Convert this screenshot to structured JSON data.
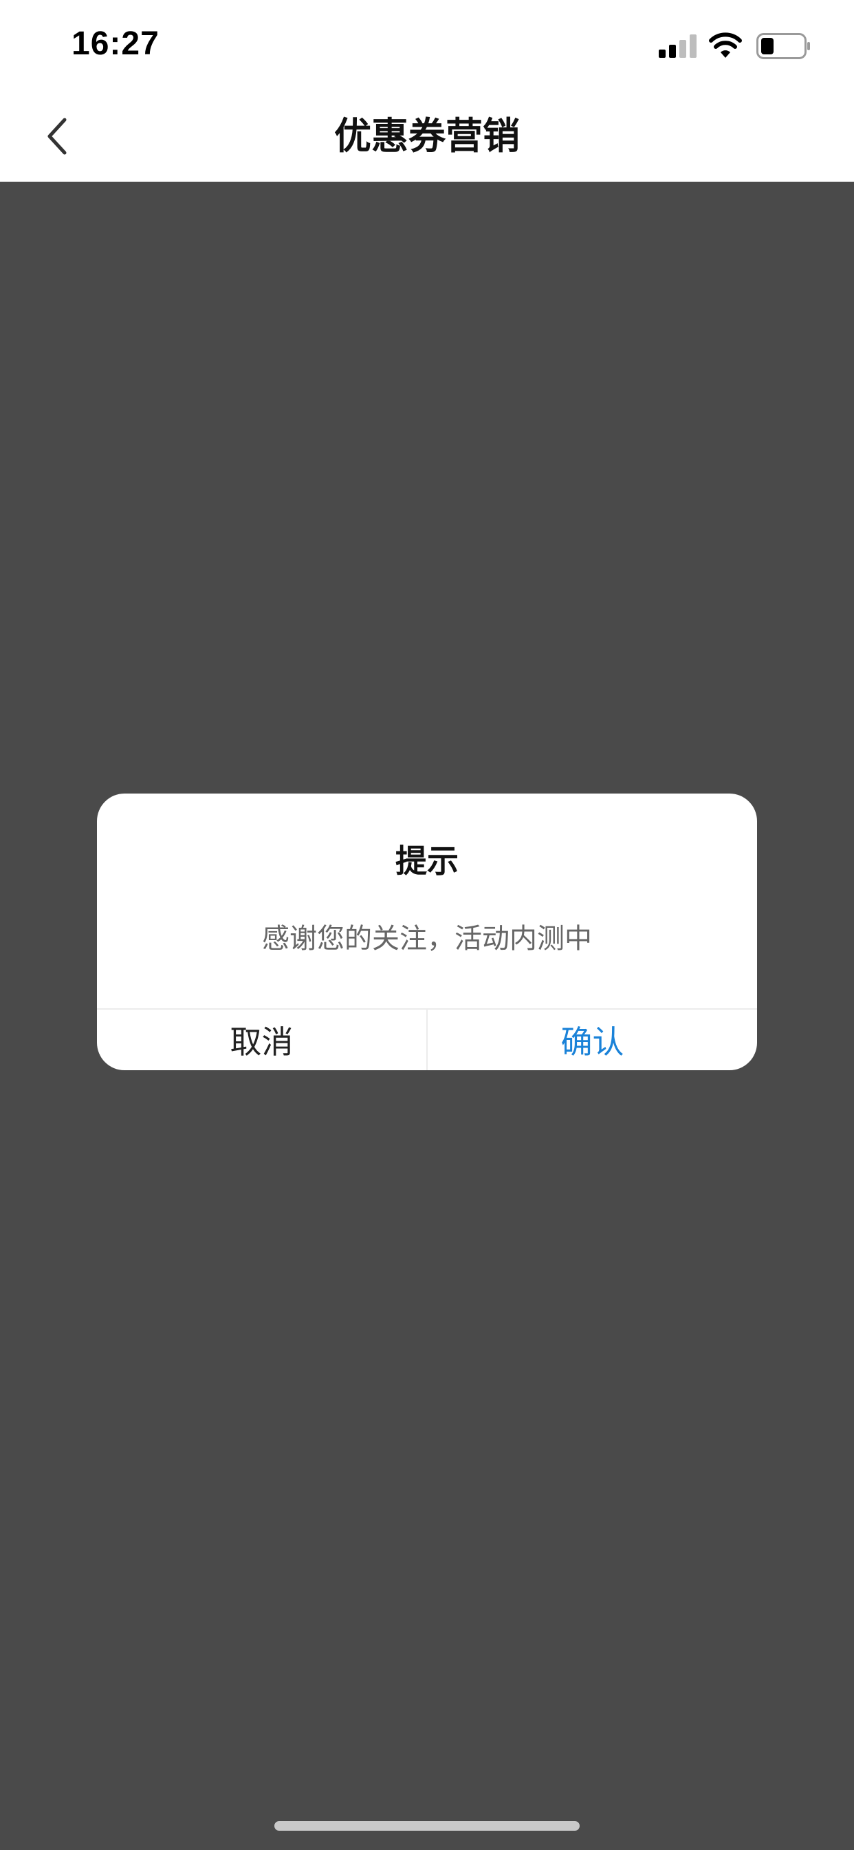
{
  "status_bar": {
    "time": "16:27",
    "icons": [
      "signal-icon",
      "wifi-icon",
      "battery-icon"
    ]
  },
  "nav": {
    "title": "优惠券营销",
    "back_icon": "chevron-left-icon"
  },
  "dialog": {
    "title": "提示",
    "message": "感谢您的关注，活动内测中",
    "cancel_label": "取消",
    "confirm_label": "确认"
  },
  "colors": {
    "overlay": "#4a4a4a",
    "accent": "#1a82d8",
    "message_text": "#666666"
  }
}
